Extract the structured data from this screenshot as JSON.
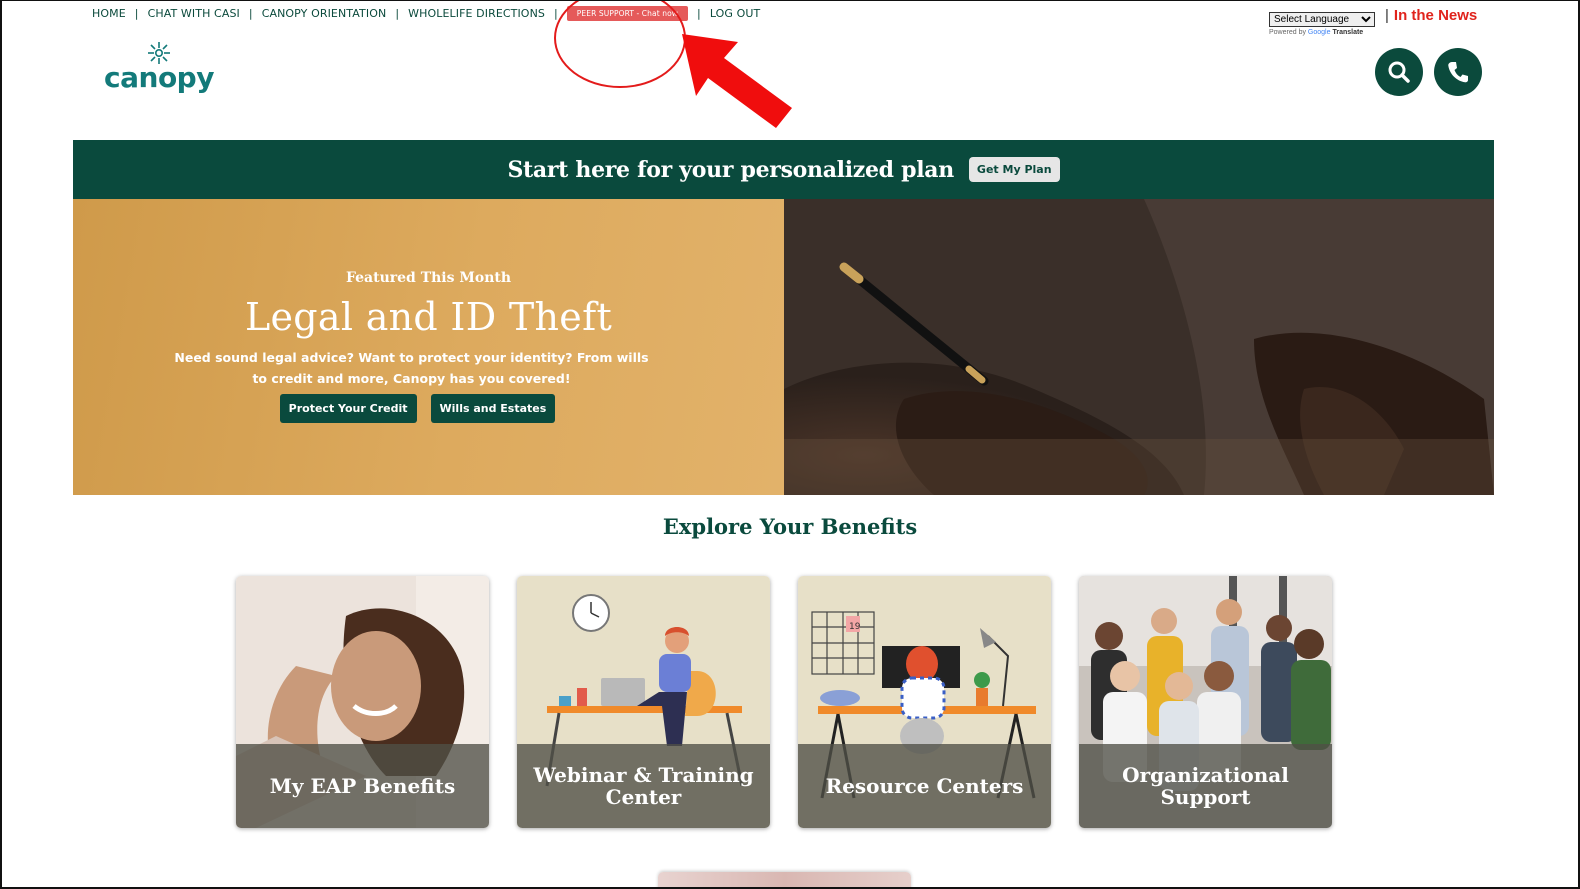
{
  "nav": {
    "home": "HOME",
    "chat": "CHAT WITH CASI",
    "orientation": "CANOPY ORIENTATION",
    "directions": "WHOLELIFE DIRECTIONS",
    "peer_support": "PEER SUPPORT - Chat now",
    "logout": "LOG OUT",
    "separator": "|"
  },
  "logo": {
    "text": "canopy",
    "color": "#137a7a"
  },
  "language": {
    "select_label": "Select Language",
    "powered_prefix": "Powered by",
    "google": "Google",
    "translate": "Translate"
  },
  "news_link": "In the News",
  "icons": {
    "search": "search-icon",
    "phone": "phone-icon"
  },
  "banner": {
    "title": "Start here for your personalized plan",
    "button": "Get My Plan"
  },
  "hero": {
    "kicker": "Featured This Month",
    "title": "Legal and ID Theft",
    "description": "Need sound legal advice? Want to protect your identity? From wills to credit and more, Canopy has you covered!",
    "buttons": [
      "Protect Your Credit",
      "Wills and Estates"
    ]
  },
  "explore": {
    "heading": "Explore Your Benefits",
    "cards": [
      "My EAP Benefits",
      "Webinar & Training Center",
      "Resource Centers",
      "Organizational Support"
    ]
  },
  "calendar_day": "19",
  "colors": {
    "brand_green": "#0a4a3d",
    "accent_red": "#e0231c",
    "peer_button": "#e55a5a",
    "hero_gold": "#d9a65a"
  }
}
